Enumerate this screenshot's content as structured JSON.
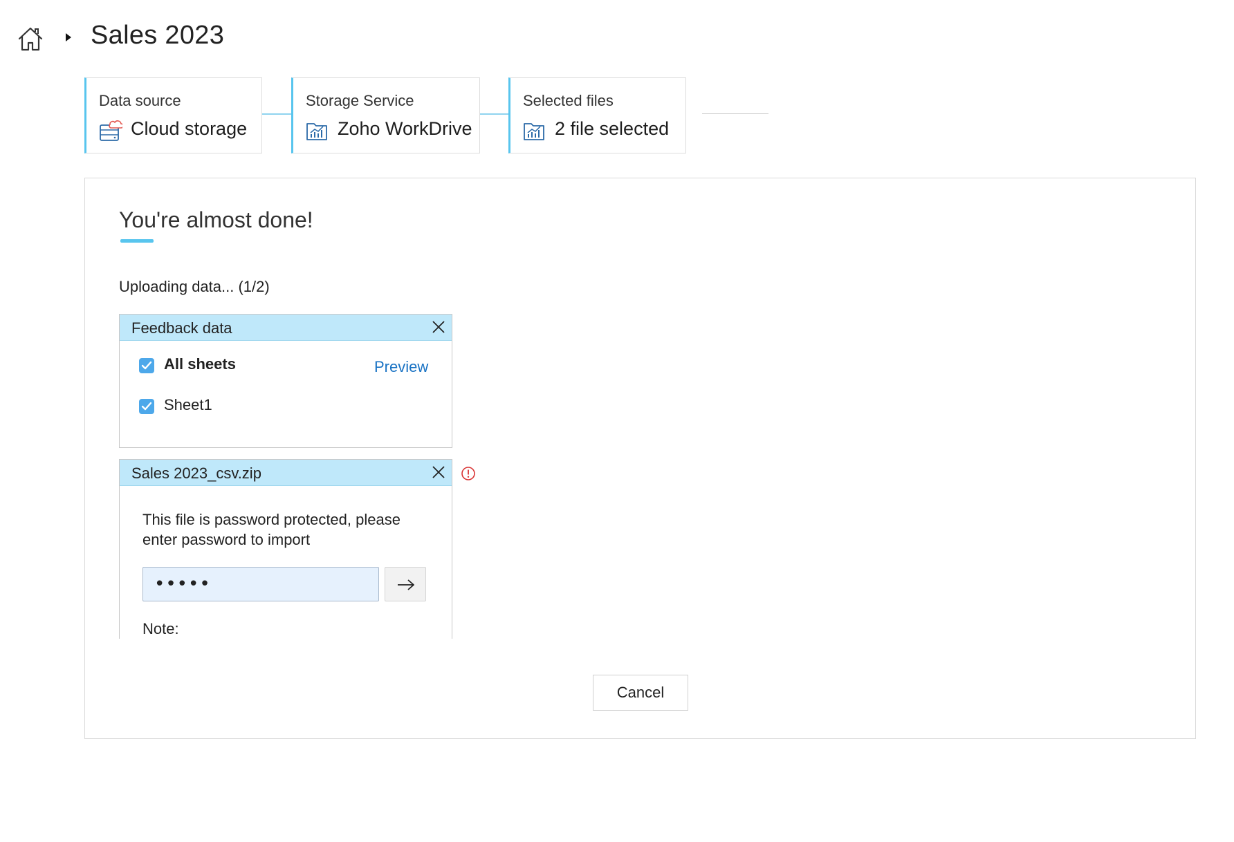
{
  "header": {
    "title": "Sales 2023",
    "home_icon": "home-icon",
    "separator_icon": "caret-right-icon"
  },
  "steps": [
    {
      "label": "Data source",
      "value": "Cloud storage",
      "icon": "cloud-storage-icon"
    },
    {
      "label": "Storage Service",
      "value": "Zoho WorkDrive",
      "icon": "folder-chart-icon"
    },
    {
      "label": "Selected files",
      "value": "2 file selected",
      "icon": "folder-chart-icon"
    }
  ],
  "main": {
    "title": "You're almost done!",
    "progress": "Uploading data... (1/2)",
    "files": [
      {
        "name": "Feedback data",
        "sheets": [
          {
            "label": "All sheets",
            "checked": true
          },
          {
            "label": "Sheet1",
            "checked": true
          }
        ],
        "preview_label": "Preview"
      },
      {
        "name": "Sales 2023_csv.zip",
        "status_icon": "error-icon",
        "message": "This file is password protected, please enter password to import",
        "password_value": "•••••",
        "submit_icon": "arrow-right-icon",
        "note_label": "Note:"
      }
    ],
    "cancel_label": "Cancel"
  },
  "colors": {
    "accent": "#58c5ee",
    "file_header_bg": "#bfe8fa",
    "link": "#1a73c4",
    "checkbox": "#4da8ea",
    "error": "#d93434",
    "input_bg": "#e6f1fd"
  }
}
